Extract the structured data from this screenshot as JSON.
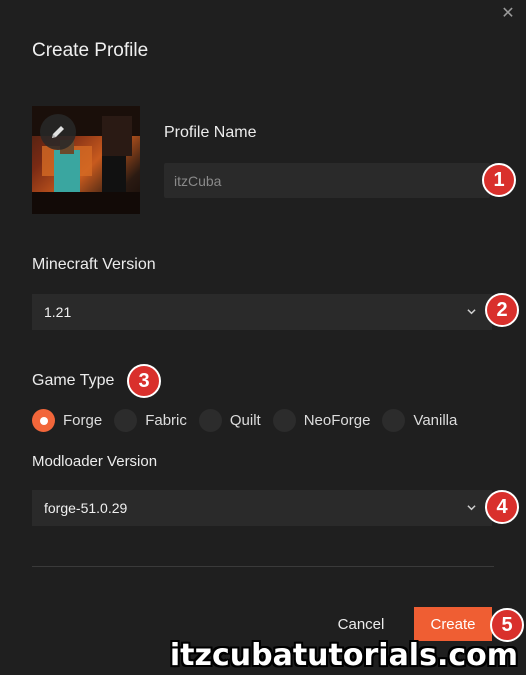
{
  "dialog": {
    "title": "Create Profile",
    "close_icon": "close-icon"
  },
  "profile_name": {
    "label": "Profile Name",
    "placeholder": "itzCuba",
    "value": ""
  },
  "minecraft_version": {
    "label": "Minecraft Version",
    "selected": "1.21"
  },
  "game_type": {
    "label": "Game Type",
    "options": [
      "Forge",
      "Fabric",
      "Quilt",
      "NeoForge",
      "Vanilla"
    ],
    "selected": "Forge"
  },
  "modloader_version": {
    "label": "Modloader Version",
    "selected": "forge-51.0.29"
  },
  "buttons": {
    "cancel": "Cancel",
    "create": "Create"
  },
  "markers": [
    "1",
    "2",
    "3",
    "4",
    "5"
  ],
  "watermark": "itzcubatutorials.com",
  "colors": {
    "accent": "#ef5e33",
    "marker": "#d9302c",
    "background": "#1f1f1f",
    "field": "#2a2a2a"
  }
}
